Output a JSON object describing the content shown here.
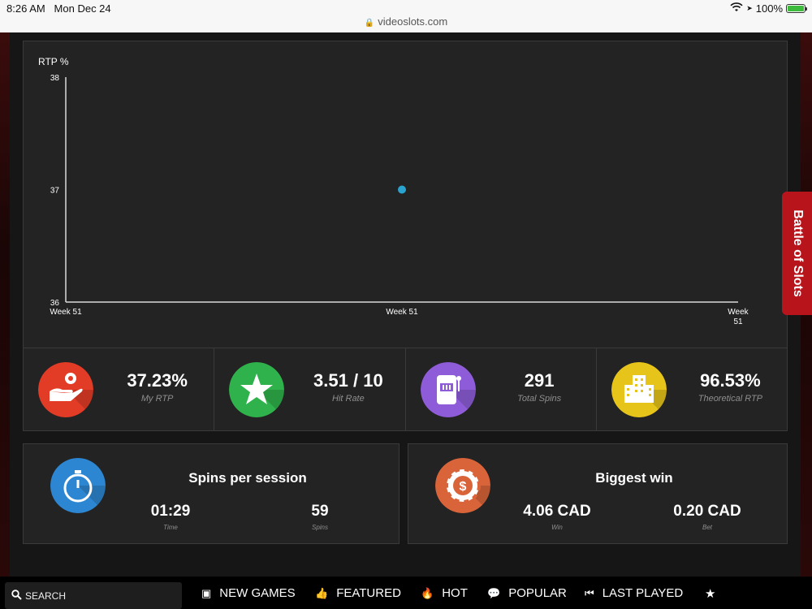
{
  "status": {
    "time": "8:26 AM",
    "date": "Mon Dec 24",
    "battery_text": "100%",
    "battery_level": 1.0,
    "url": "videoslots.com"
  },
  "chart_data": {
    "type": "scatter",
    "ylabel": "RTP %",
    "ylim": [
      36,
      38
    ],
    "yticks": [
      "38",
      "37",
      "36"
    ],
    "xticks": [
      "Week 51",
      "Week 51",
      "Week\n51"
    ],
    "series": [
      {
        "x": [
          "Week 51"
        ],
        "y": [
          37
        ],
        "color": "#2aa3cf"
      }
    ],
    "axis_color": "#d9d9d9"
  },
  "stats": [
    {
      "value": "37.23%",
      "label": "My RTP",
      "icon": "coin-hand-icon",
      "color": "#e23c26"
    },
    {
      "value": "3.51 / 10",
      "label": "Hit Rate",
      "icon": "star-icon",
      "color": "#2fb14b"
    },
    {
      "value": "291",
      "label": "Total Spins",
      "icon": "slot-machine-icon",
      "color": "#8e5cd8"
    },
    {
      "value": "96.53%",
      "label": "Theoretical RTP",
      "icon": "casino-building-icon",
      "color": "#e6c41a"
    }
  ],
  "sessions": {
    "title": "Spins per session",
    "time_value": "01:29",
    "time_label": "Time",
    "spins_value": "59",
    "spins_label": "Spins",
    "icon_color": "#2d86d1"
  },
  "biggest": {
    "title": "Biggest win",
    "win_value": "4.06 CAD",
    "win_label": "Win",
    "bet_value": "0.20 CAD",
    "bet_label": "Bet",
    "icon_color": "#d9643a"
  },
  "battle_tab": "Battle of Slots",
  "nav": {
    "search": "SEARCH",
    "items": [
      "NEW GAMES",
      "FEATURED",
      "HOT",
      "POPULAR",
      "LAST PLAYED"
    ]
  }
}
